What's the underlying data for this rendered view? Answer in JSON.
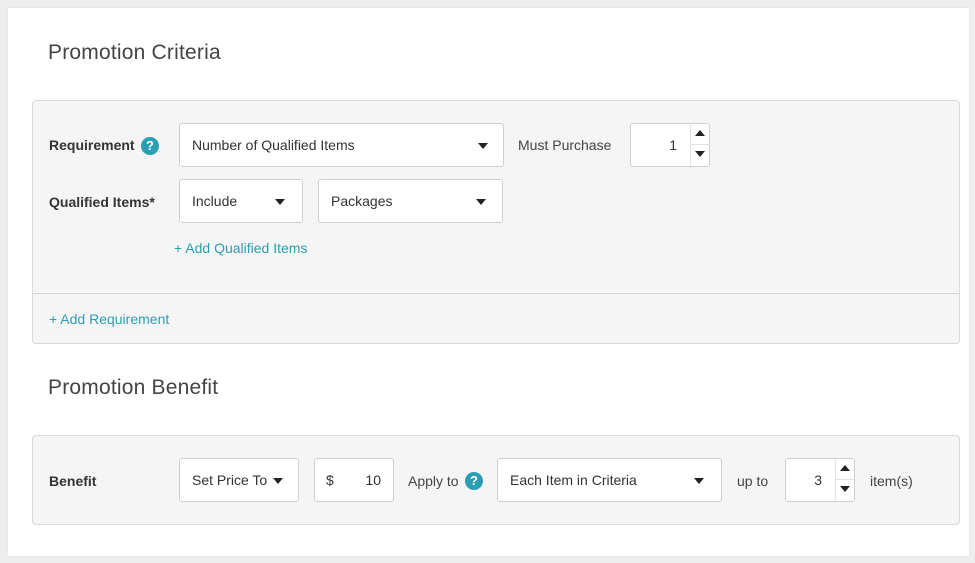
{
  "criteria": {
    "title": "Promotion Criteria",
    "requirement_label": "Requirement",
    "requirement_help": "?",
    "requirement_select": "Number of Qualified Items",
    "must_purchase_label": "Must Purchase",
    "must_purchase_value": "1",
    "qualified_items_label": "Qualified Items*",
    "include_select": "Include",
    "packages_select": "Packages",
    "add_qualified_items": "+ Add Qualified Items",
    "add_requirement": "+ Add Requirement"
  },
  "benefit": {
    "title": "Promotion Benefit",
    "benefit_label": "Benefit",
    "set_price_select": "Set Price To",
    "currency_symbol": "$",
    "price_value": "10",
    "apply_to_label": "Apply to",
    "apply_to_help": "?",
    "apply_to_select": "Each Item in Criteria",
    "up_to_label": "up to",
    "up_to_value": "3",
    "items_suffix": "item(s)"
  },
  "colors": {
    "accent": "#2a9fb4",
    "panel_bg": "#f5f5f5",
    "page_bg": "#eeeeee"
  },
  "icons": {
    "help": "question-circle-icon",
    "dropdown": "caret-down-icon",
    "step_up": "caret-up-icon",
    "step_down": "caret-down-icon"
  }
}
